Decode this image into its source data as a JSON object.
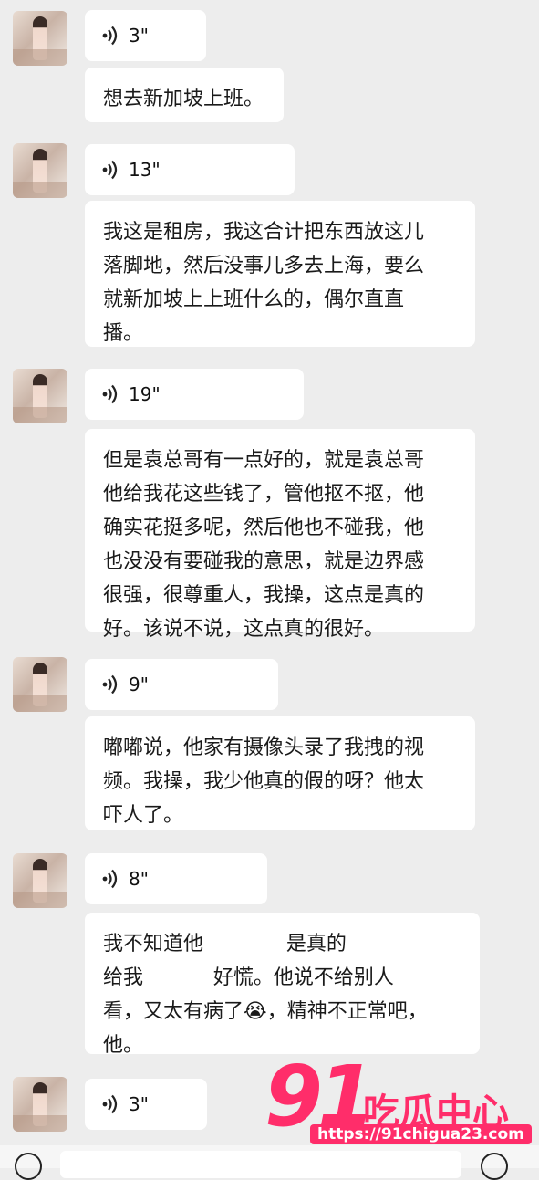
{
  "colors": {
    "background": "#ededed",
    "bubble": "#ffffff",
    "watermark": "#ff2d6a"
  },
  "messages": [
    {
      "voice_duration": "3\"",
      "text": "想去新加坡上班。"
    },
    {
      "voice_duration": "13\"",
      "text": "我这是租房，我这合计把东西放这儿\n落脚地，然后没事儿多去上海，要么\n就新加坡上上班什么的，偶尔直直\n播。"
    },
    {
      "voice_duration": "19\"",
      "text": "但是袁总哥有一点好的，就是袁总哥\n他给我花这些钱了，管他抠不抠，他\n确实花挺多呢，然后他也不碰我，他\n也没没有要碰我的意思，就是边界感\n很强，很尊重人，我操，这点是真的\n好。该说不说，这点真的很好。"
    },
    {
      "voice_duration": "9\"",
      "text": "嘟嘟说，他家有摄像头录了我拽的视\n频。我操，我少他真的假的呀？他太\n吓人了。"
    },
    {
      "voice_duration": "8\"",
      "text": "我不知道他             是真的\n给我           好慌。他说不给别人\n看，又太有病了😭，精神不正常吧，\n他。"
    },
    {
      "voice_duration": "3\"",
      "text": ""
    }
  ],
  "watermark": {
    "number": "91",
    "brand": "吃瓜中心",
    "url": "https://91chigua23.com"
  }
}
